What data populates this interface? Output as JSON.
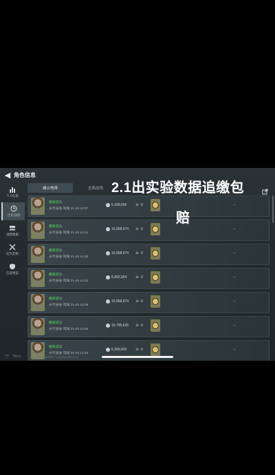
{
  "header": {
    "back_icon": "back-arrow-icon",
    "title": "角色信息"
  },
  "sidebar": {
    "items": [
      {
        "label": "个人信息",
        "icon": "bar-chart-icon",
        "active": false
      },
      {
        "label": "历史战绩",
        "icon": "clock-icon",
        "active": true
      },
      {
        "label": "战绩数据",
        "icon": "stack-icon",
        "active": false
      },
      {
        "label": "社交定制",
        "icon": "tools-icon",
        "active": false
      },
      {
        "label": "信誉档案",
        "icon": "shield-icon",
        "active": false
      }
    ]
  },
  "tabs": [
    {
      "label": "烽火地带",
      "active": true
    },
    {
      "label": "全面战场",
      "active": false
    }
  ],
  "rows": [
    {
      "status": "撤离成功",
      "mode": "长弓溪谷-常规 01-25 14:57",
      "value": "5,189,556",
      "kills": "0",
      "result": "--"
    },
    {
      "status": "撤离成功",
      "mode": "长弓溪谷-常规 01-25 14:41",
      "value": "15,568,674",
      "kills": "0",
      "result": "--"
    },
    {
      "status": "撤离成功",
      "mode": "长弓溪谷-常规 01-25 14:30",
      "value": "15,568,674",
      "kills": "0",
      "result": "--"
    },
    {
      "status": "撤离成功",
      "mode": "长弓溪谷-常规 01-25 14:22",
      "value": "6,492,004",
      "kills": "0",
      "result": "--"
    },
    {
      "status": "撤离成功",
      "mode": "长弓溪谷-常规 01-25 14:09",
      "value": "15,568,674",
      "kills": "0",
      "result": "--"
    },
    {
      "status": "撤离成功",
      "mode": "长弓溪谷-常规 01-25 13:53",
      "value": "15,795,626",
      "kills": "0",
      "result": "--"
    },
    {
      "status": "撤离成功",
      "mode": "长弓溪谷-常规 01-25 13:43",
      "value": "6,369,003",
      "kills": "0",
      "result": "--"
    }
  ],
  "footer": {
    "network": "78ms",
    "uid": "CH.UID 1658877102885426517040"
  },
  "overlay": {
    "line1": "2.1出实验数据追缴包",
    "line2": "赔"
  },
  "colors": {
    "success": "#58d36b",
    "panel": "#2a3236"
  }
}
